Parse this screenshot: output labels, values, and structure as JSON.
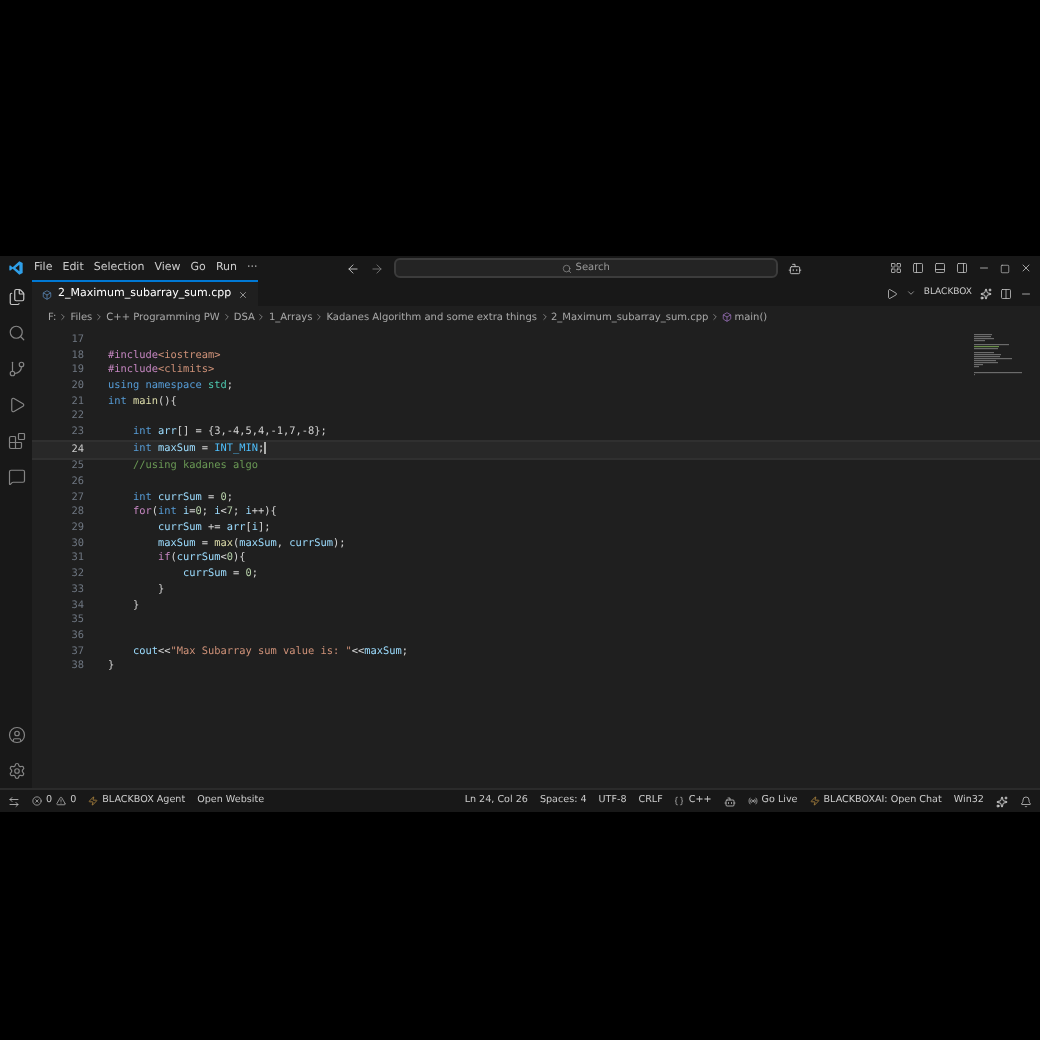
{
  "menu": [
    "File",
    "Edit",
    "Selection",
    "View",
    "Go",
    "Run",
    "···"
  ],
  "search": {
    "placeholder": "Search"
  },
  "tab": {
    "label": "2_Maximum_subarray_sum.cpp",
    "selected": true
  },
  "editor_actions": {
    "label": "BLACKBOX"
  },
  "breadcrumb": [
    "F:",
    "Files",
    "C++ Programming PW",
    "DSA",
    "1_Arrays",
    "Kadanes Algorithm and some extra things",
    "2_Maximum_subarray_sum.cpp",
    "main()"
  ],
  "code": [
    {
      "number": "17",
      "selected": false
    },
    {
      "number": "18",
      "selected": false,
      "tokens": [
        {
          "kind": "pre",
          "text": "#include"
        },
        {
          "kind": "str",
          "text": "<iostream>"
        }
      ]
    },
    {
      "number": "19",
      "selected": false,
      "tokens": [
        {
          "kind": "pre",
          "text": "#include"
        },
        {
          "kind": "str",
          "text": "<climits>"
        }
      ]
    },
    {
      "number": "20",
      "selected": false,
      "tokens": [
        {
          "kind": "kw",
          "text": "using namespace"
        },
        {
          "kind": "ns",
          "text": " std"
        },
        {
          "kind": "plain",
          "text": ";"
        }
      ]
    },
    {
      "number": "21",
      "selected": false,
      "tokens": [
        {
          "kind": "kw",
          "text": "int"
        },
        {
          "kind": "fn",
          "text": " main"
        },
        {
          "kind": "plain",
          "text": "(){"
        }
      ]
    },
    {
      "number": "22",
      "selected": false
    },
    {
      "number": "23",
      "selected": false,
      "tokens": [
        {
          "kind": "kw",
          "text": "    int"
        },
        {
          "kind": "var",
          "text": " arr"
        },
        {
          "kind": "plain",
          "text": "[] = {3,-4,5,4,-1,7,-8};"
        }
      ]
    },
    {
      "number": "24",
      "selected": true,
      "tokens": [
        {
          "kind": "kw",
          "text": "    int"
        },
        {
          "kind": "var",
          "text": " maxSum"
        },
        {
          "kind": "plain",
          "text": " = "
        },
        {
          "kind": "mac",
          "text": "INT_MIN"
        },
        {
          "kind": "plain",
          "text": ";"
        }
      ]
    },
    {
      "number": "25",
      "selected": false,
      "tokens": [
        {
          "kind": "com",
          "text": "    //using kadanes algo"
        }
      ]
    },
    {
      "number": "26",
      "selected": false
    },
    {
      "number": "27",
      "selected": false,
      "tokens": [
        {
          "kind": "kw",
          "text": "    int"
        },
        {
          "kind": "var",
          "text": " currSum"
        },
        {
          "kind": "plain",
          "text": " = "
        },
        {
          "kind": "num",
          "text": "0"
        },
        {
          "kind": "plain",
          "text": ";"
        }
      ]
    },
    {
      "number": "28",
      "selected": false,
      "tokens": [
        {
          "kind": "ctl",
          "text": "    for"
        },
        {
          "kind": "plain",
          "text": "("
        },
        {
          "kind": "kw",
          "text": "int"
        },
        {
          "kind": "var",
          "text": " i"
        },
        {
          "kind": "plain",
          "text": "="
        },
        {
          "kind": "num",
          "text": "0"
        },
        {
          "kind": "plain",
          "text": ";"
        },
        {
          "kind": "var",
          "text": " i"
        },
        {
          "kind": "plain",
          "text": "<"
        },
        {
          "kind": "num",
          "text": "7"
        },
        {
          "kind": "plain",
          "text": ";"
        },
        {
          "kind": "var",
          "text": " i"
        },
        {
          "kind": "plain",
          "text": "++){"
        }
      ]
    },
    {
      "number": "29",
      "selected": false,
      "tokens": [
        {
          "kind": "var",
          "text": "        currSum"
        },
        {
          "kind": "plain",
          "text": " += "
        },
        {
          "kind": "var",
          "text": "arr"
        },
        {
          "kind": "plain",
          "text": "["
        },
        {
          "kind": "var",
          "text": "i"
        },
        {
          "kind": "plain",
          "text": "];"
        }
      ]
    },
    {
      "number": "30",
      "selected": false,
      "tokens": [
        {
          "kind": "var",
          "text": "        maxSum"
        },
        {
          "kind": "plain",
          "text": " = "
        },
        {
          "kind": "fn",
          "text": "max"
        },
        {
          "kind": "plain",
          "text": "("
        },
        {
          "kind": "var",
          "text": "maxSum"
        },
        {
          "kind": "plain",
          "text": ","
        },
        {
          "kind": "var",
          "text": " currSum"
        },
        {
          "kind": "plain",
          "text": ");"
        }
      ]
    },
    {
      "number": "31",
      "selected": false,
      "tokens": [
        {
          "kind": "ctl",
          "text": "        if"
        },
        {
          "kind": "plain",
          "text": "("
        },
        {
          "kind": "var",
          "text": "currSum"
        },
        {
          "kind": "plain",
          "text": "<"
        },
        {
          "kind": "num",
          "text": "0"
        },
        {
          "kind": "plain",
          "text": "){"
        }
      ]
    },
    {
      "number": "32",
      "selected": false,
      "tokens": [
        {
          "kind": "var",
          "text": "            currSum"
        },
        {
          "kind": "plain",
          "text": " = "
        },
        {
          "kind": "num",
          "text": "0"
        },
        {
          "kind": "plain",
          "text": ";"
        }
      ]
    },
    {
      "number": "33",
      "selected": false,
      "tokens": [
        {
          "kind": "plain",
          "text": "        }"
        }
      ]
    },
    {
      "number": "34",
      "selected": false,
      "tokens": [
        {
          "kind": "plain",
          "text": "    }"
        }
      ]
    },
    {
      "number": "35",
      "selected": false
    },
    {
      "number": "36",
      "selected": false
    },
    {
      "number": "37",
      "selected": false,
      "tokens": [
        {
          "kind": "var",
          "text": "    cout"
        },
        {
          "kind": "plain",
          "text": "<<"
        },
        {
          "kind": "str",
          "text": "\"Max Subarray sum value is: \""
        },
        {
          "kind": "plain",
          "text": "<<"
        },
        {
          "kind": "var",
          "text": "maxSum"
        },
        {
          "kind": "plain",
          "text": ";"
        }
      ]
    },
    {
      "number": "38",
      "selected": false,
      "tokens": [
        {
          "kind": "plain",
          "text": "}"
        }
      ]
    }
  ],
  "status_bar": {
    "left": [
      {
        "kind": "remote"
      },
      {
        "kind": "problems",
        "errors": "0",
        "warnings": "0"
      },
      {
        "kind": "agent",
        "text": "BLACKBOX Agent"
      },
      {
        "kind": "text",
        "text": "Open Website"
      }
    ],
    "right": [
      {
        "kind": "text",
        "text": "Ln 24, Col 26"
      },
      {
        "kind": "text",
        "text": "Spaces: 4"
      },
      {
        "kind": "text",
        "text": "UTF-8"
      },
      {
        "kind": "text",
        "text": "CRLF"
      },
      {
        "kind": "language",
        "text": "C++"
      },
      {
        "kind": "copilot"
      },
      {
        "kind": "golive",
        "text": "Go Live"
      },
      {
        "kind": "agent",
        "text": "BLACKBOXAI: Open Chat"
      },
      {
        "kind": "text",
        "text": "Win32"
      },
      {
        "kind": "sparkle"
      },
      {
        "kind": "bell"
      }
    ]
  }
}
